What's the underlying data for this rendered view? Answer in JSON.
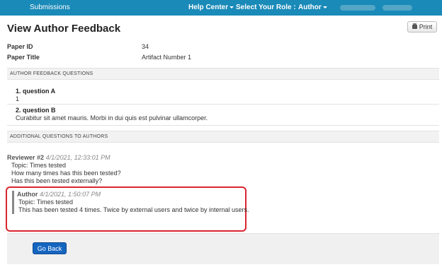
{
  "topbar": {
    "brand": "Submissions",
    "help_center": "Help Center",
    "select_role": "Select Your Role :",
    "role": "Author"
  },
  "page": {
    "title": "View Author Feedback",
    "print_label": "Print"
  },
  "meta": {
    "paper_id_label": "Paper ID",
    "paper_id": "34",
    "paper_title_label": "Paper Title",
    "paper_title": "Artifact Number 1"
  },
  "feedback": {
    "header": "AUTHOR FEEDBACK QUESTIONS",
    "questions": [
      {
        "title": "1. question A",
        "answer": "1"
      },
      {
        "title": "2. question B",
        "answer": "Curabitur sit amet mauris. Morbi in dui quis est pulvinar ullamcorper."
      }
    ]
  },
  "additional": {
    "header": "ADDITIONAL QUESTIONS TO AUTHORS",
    "reviewer": {
      "name": "Reviewer #2",
      "timestamp": "4/1/2021, 12:33:01 PM",
      "lines": [
        "Topic: Times tested",
        "How many times has this been tested?",
        "Has this been tested externally?"
      ]
    },
    "author_reply": {
      "name": "Author",
      "timestamp": "4/1/2021, 1:50:07 PM",
      "lines": [
        "Topic: Times tested",
        "This has been tested 4 times. Twice by external users and twice by internal users."
      ]
    }
  },
  "footer": {
    "go_back": "Go Back"
  },
  "colors": {
    "topbar": "#1a8ab8",
    "primary_button": "#1565c0",
    "highlight": "#d9262e"
  }
}
